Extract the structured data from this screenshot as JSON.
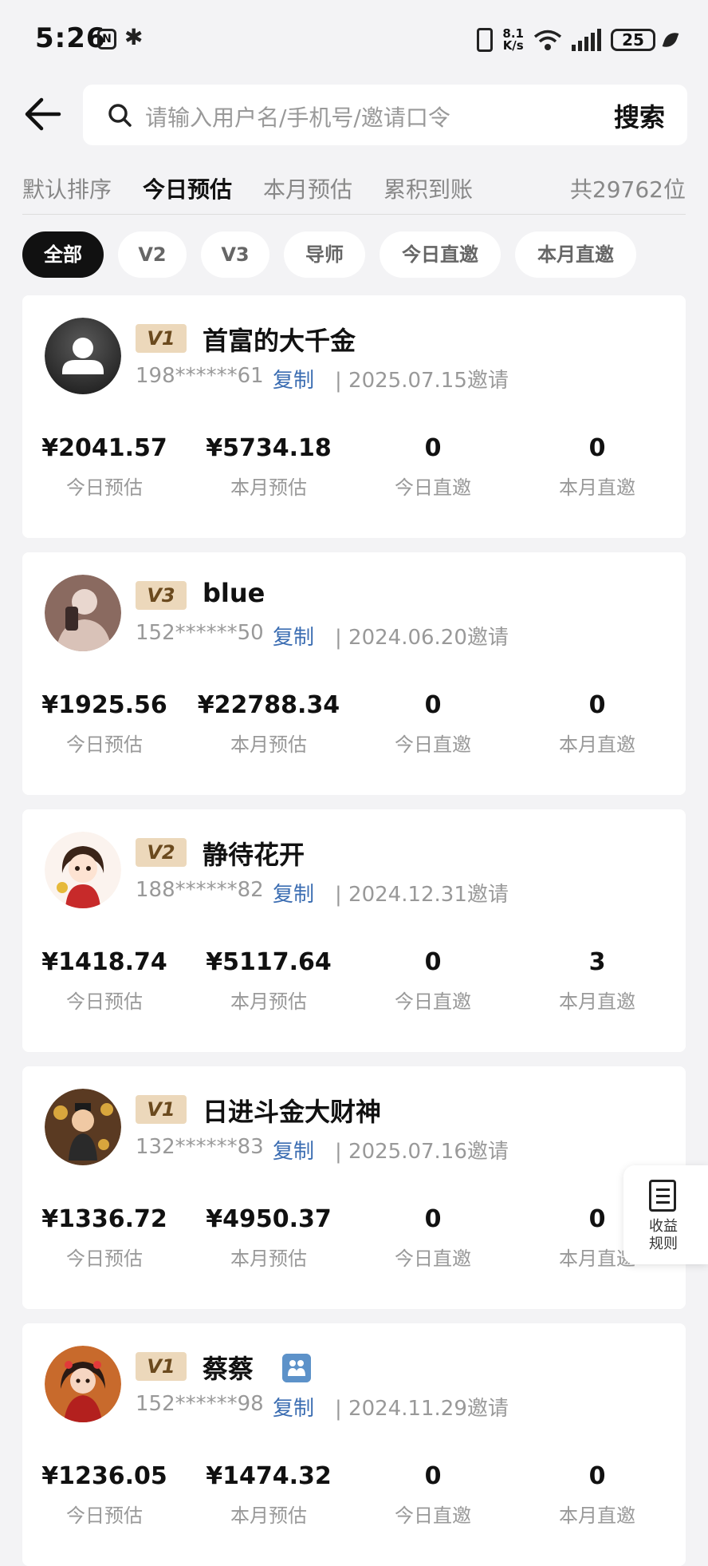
{
  "status_bar": {
    "time": "5:26",
    "net_speed_top": "8.1",
    "net_speed_bottom": "K/s",
    "network": "6",
    "battery": "25"
  },
  "search": {
    "placeholder": "请输入用户名/手机号/邀请口令",
    "button": "搜索"
  },
  "sort_tabs": [
    "默认排序",
    "今日预估",
    "本月预估",
    "累积到账"
  ],
  "active_sort": "今日预估",
  "total": "共29762位",
  "filters": [
    "全部",
    "V2",
    "V3",
    "导师",
    "今日直邀",
    "本月直邀"
  ],
  "active_filter": "全部",
  "stat_labels": [
    "今日预估",
    "本月预估",
    "今日直邀",
    "本月直邀"
  ],
  "copy_label": "复制",
  "members": [
    {
      "level": "V1",
      "name": "首富的大千金",
      "phone": "198******61",
      "invite": "| 2025.07.15邀请",
      "today_est": "¥2041.57",
      "month_est": "¥5734.18",
      "today_invites": "0",
      "month_invites": "0"
    },
    {
      "level": "V3",
      "name": "blue",
      "phone": "152******50",
      "invite": "| 2024.06.20邀请",
      "today_est": "¥1925.56",
      "month_est": "¥22788.34",
      "today_invites": "0",
      "month_invites": "0"
    },
    {
      "level": "V2",
      "name": "静待花开",
      "phone": "188******82",
      "invite": "| 2024.12.31邀请",
      "today_est": "¥1418.74",
      "month_est": "¥5117.64",
      "today_invites": "0",
      "month_invites": "3"
    },
    {
      "level": "V1",
      "name": "日进斗金大财神",
      "phone": "132******83",
      "invite": "| 2025.07.16邀请",
      "today_est": "¥1336.72",
      "month_est": "¥4950.37",
      "today_invites": "0",
      "month_invites": "0"
    },
    {
      "level": "V1",
      "name": "蔡蔡",
      "phone": "152******98",
      "invite": "| 2024.11.29邀请",
      "today_est": "¥1236.05",
      "month_est": "¥1474.32",
      "today_invites": "0",
      "month_invites": "0"
    }
  ],
  "floating": {
    "line1": "收益",
    "line2": "规则"
  },
  "colors": {
    "accent_blue": "#3b6db2",
    "level_badge_bg": "#ecd8bb",
    "level_badge_text": "#6b4a1e"
  }
}
